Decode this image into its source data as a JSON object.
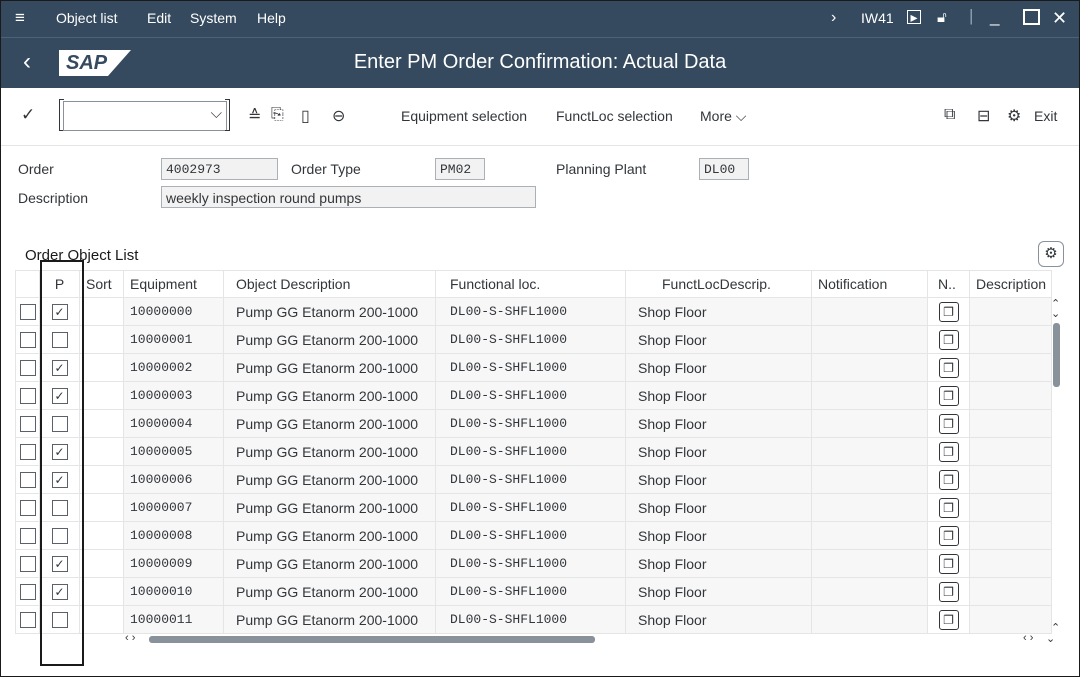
{
  "menubar": {
    "items": [
      "Object list",
      "Edit",
      "System",
      "Help"
    ],
    "tcode": "IW41"
  },
  "titlebar": {
    "title": "Enter PM Order Confirmation: Actual Data",
    "logo": "SAP"
  },
  "toolbar": {
    "command_value": "",
    "equipment_selection": "Equipment selection",
    "functloc_selection": "FunctLoc selection",
    "more": "More",
    "exit": "Exit"
  },
  "header": {
    "order_label": "Order",
    "order_value": "4002973",
    "order_type_label": "Order Type",
    "order_type_value": "PM02",
    "planning_plant_label": "Planning Plant",
    "planning_plant_value": "DL00",
    "description_label": "Description",
    "description_value": "weekly inspection round pumps"
  },
  "list": {
    "title": "Order Object List",
    "columns": [
      "P",
      "Sort",
      "Equipment",
      "Object Description",
      "Functional loc.",
      "FunctLocDescrip.",
      "Notification",
      "N..",
      "Description"
    ],
    "rows": [
      {
        "p": true,
        "equipment": "10000000",
        "object_desc": "Pump GG Etanorm 200-1000",
        "func_loc": "DL00-S-SHFL1000",
        "floc_desc": "Shop Floor"
      },
      {
        "p": false,
        "equipment": "10000001",
        "object_desc": "Pump GG Etanorm 200-1000",
        "func_loc": "DL00-S-SHFL1000",
        "floc_desc": "Shop Floor"
      },
      {
        "p": true,
        "equipment": "10000002",
        "object_desc": "Pump GG Etanorm 200-1000",
        "func_loc": "DL00-S-SHFL1000",
        "floc_desc": "Shop Floor"
      },
      {
        "p": true,
        "equipment": "10000003",
        "object_desc": "Pump GG Etanorm 200-1000",
        "func_loc": "DL00-S-SHFL1000",
        "floc_desc": "Shop Floor"
      },
      {
        "p": false,
        "equipment": "10000004",
        "object_desc": "Pump GG Etanorm 200-1000",
        "func_loc": "DL00-S-SHFL1000",
        "floc_desc": "Shop Floor"
      },
      {
        "p": true,
        "equipment": "10000005",
        "object_desc": "Pump GG Etanorm 200-1000",
        "func_loc": "DL00-S-SHFL1000",
        "floc_desc": "Shop Floor"
      },
      {
        "p": true,
        "equipment": "10000006",
        "object_desc": "Pump GG Etanorm 200-1000",
        "func_loc": "DL00-S-SHFL1000",
        "floc_desc": "Shop Floor"
      },
      {
        "p": false,
        "equipment": "10000007",
        "object_desc": "Pump GG Etanorm 200-1000",
        "func_loc": "DL00-S-SHFL1000",
        "floc_desc": "Shop Floor"
      },
      {
        "p": false,
        "equipment": "10000008",
        "object_desc": "Pump GG Etanorm 200-1000",
        "func_loc": "DL00-S-SHFL1000",
        "floc_desc": "Shop Floor"
      },
      {
        "p": true,
        "equipment": "10000009",
        "object_desc": "Pump GG Etanorm 200-1000",
        "func_loc": "DL00-S-SHFL1000",
        "floc_desc": "Shop Floor"
      },
      {
        "p": true,
        "equipment": "10000010",
        "object_desc": "Pump GG Etanorm 200-1000",
        "func_loc": "DL00-S-SHFL1000",
        "floc_desc": "Shop Floor"
      },
      {
        "p": false,
        "equipment": "10000011",
        "object_desc": "Pump GG Etanorm 200-1000",
        "func_loc": "DL00-S-SHFL1000",
        "floc_desc": "Shop Floor"
      }
    ]
  },
  "icons": {
    "menu": "hamburger-icon",
    "back": "back-arrow-icon",
    "checkmark": "checkmark-icon",
    "settings": "gear-icon",
    "document": "document-icon"
  },
  "colors": {
    "shell": "#354a5f",
    "highlight_border": "#1a1a1a"
  }
}
